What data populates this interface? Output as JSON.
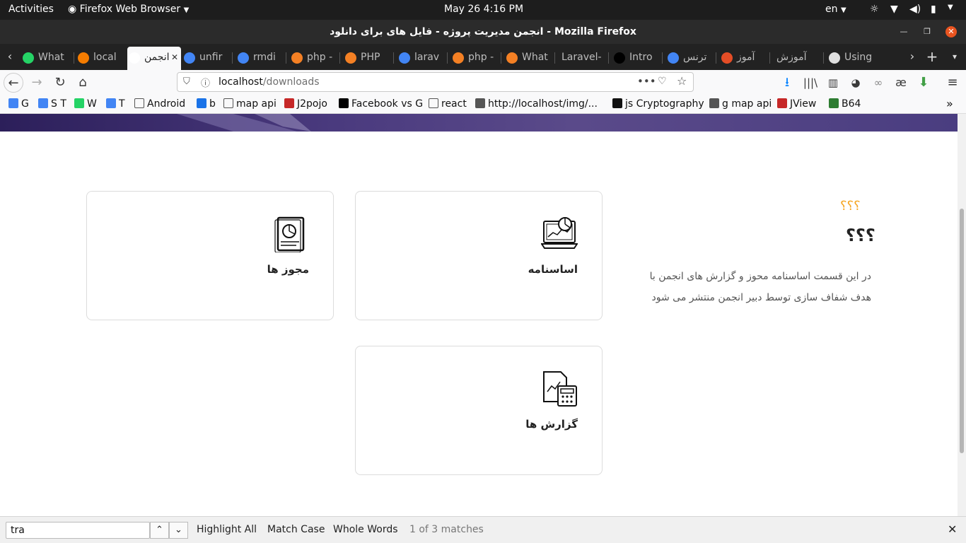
{
  "topbar": {
    "activities": "Activities",
    "app": "Firefox Web Browser",
    "clock": "May 26   4:16 PM",
    "lang": "en"
  },
  "window": {
    "title": "انجمن مدیریت پروژه - فایل های برای دانلود - Mozilla Firefox"
  },
  "tabs": [
    {
      "label": "What",
      "icon": "whatsapp-icon",
      "color": "#25d366"
    },
    {
      "label": "local",
      "icon": "xampp-icon",
      "color": "#f57c00"
    },
    {
      "label": "انجمن",
      "icon": "site-icon",
      "color": "#ffffff",
      "active": true
    },
    {
      "label": "unfir",
      "icon": "google-icon",
      "color": "#4285f4"
    },
    {
      "label": "rmdi",
      "icon": "google-icon",
      "color": "#4285f4"
    },
    {
      "label": "php -",
      "icon": "stackoverflow-icon",
      "color": "#f48024"
    },
    {
      "label": "PHP",
      "icon": "stackoverflow-icon",
      "color": "#f48024"
    },
    {
      "label": "larav",
      "icon": "google-icon",
      "color": "#4285f4"
    },
    {
      "label": "php -",
      "icon": "stackoverflow-icon",
      "color": "#f48024"
    },
    {
      "label": "What",
      "icon": "stackoverflow-icon",
      "color": "#f48024"
    },
    {
      "label": "Laravel-",
      "icon": "none",
      "color": "#222222"
    },
    {
      "label": "Intro",
      "icon": "medium-icon",
      "color": "#000000"
    },
    {
      "label": "ترنس",
      "icon": "google-icon",
      "color": "#4285f4"
    },
    {
      "label": "آموز",
      "icon": "joomla-icon",
      "color": "#e44d26"
    },
    {
      "label": "آموزش",
      "icon": "none",
      "color": "#222222"
    },
    {
      "label": "Using",
      "icon": "warning-icon",
      "color": "#e0e0e0"
    }
  ],
  "nav": {
    "url_host": "localhost",
    "url_path": "/downloads"
  },
  "bookmarks": [
    {
      "label": "G",
      "icon": "google-icon",
      "color": "#4285f4"
    },
    {
      "label": "S T",
      "icon": "translate-icon",
      "color": "#4285f4"
    },
    {
      "label": "W",
      "icon": "whatsapp-icon",
      "color": "#25d366"
    },
    {
      "label": "T",
      "icon": "translate-icon",
      "color": "#4285f4"
    },
    {
      "label": "Android",
      "icon": "folder-icon",
      "color": "#555555"
    },
    {
      "label": "b",
      "icon": "bookmark-icon",
      "color": "#1a73e8"
    },
    {
      "label": "map api",
      "icon": "folder-icon",
      "color": "#555555"
    },
    {
      "label": "J2pojo",
      "icon": "json-icon",
      "color": "#c62828"
    },
    {
      "label": "Facebook vs G",
      "icon": "medium-icon",
      "color": "#000000"
    },
    {
      "label": "react",
      "icon": "folder-icon",
      "color": "#555555"
    },
    {
      "label": "http://localhost/img/...",
      "icon": "globe-icon",
      "color": "#555555"
    },
    {
      "label": "js Cryptography",
      "icon": "github-icon",
      "color": "#111111"
    },
    {
      "label": "g map api",
      "icon": "globe-icon",
      "color": "#555555"
    },
    {
      "label": "JView",
      "icon": "jview-icon",
      "color": "#c62828"
    },
    {
      "label": "B64",
      "icon": "b64-icon",
      "color": "#2e7d32"
    }
  ],
  "section": {
    "kicker": "؟؟؟",
    "heading": "؟؟؟",
    "description_line1": "در این قسمت اساسنامه محوز و گزارش های انجمن با",
    "description_line2": "هدف شفاف سازی توسط دبیر انجمن منتشر می شود",
    "accent_color": "#f5a623"
  },
  "cards": [
    {
      "title": "اساسنامه",
      "icon": "laptop-chart-icon"
    },
    {
      "title": "مجوز ها",
      "icon": "document-pie-chart-icon"
    },
    {
      "title": "گزارش ها",
      "icon": "document-calculator-icon"
    }
  ],
  "findbar": {
    "query": "tra",
    "highlight_all": "Highlight All",
    "match_case": "Match Case",
    "whole_words": "Whole Words",
    "status": "1 of 3 matches"
  }
}
